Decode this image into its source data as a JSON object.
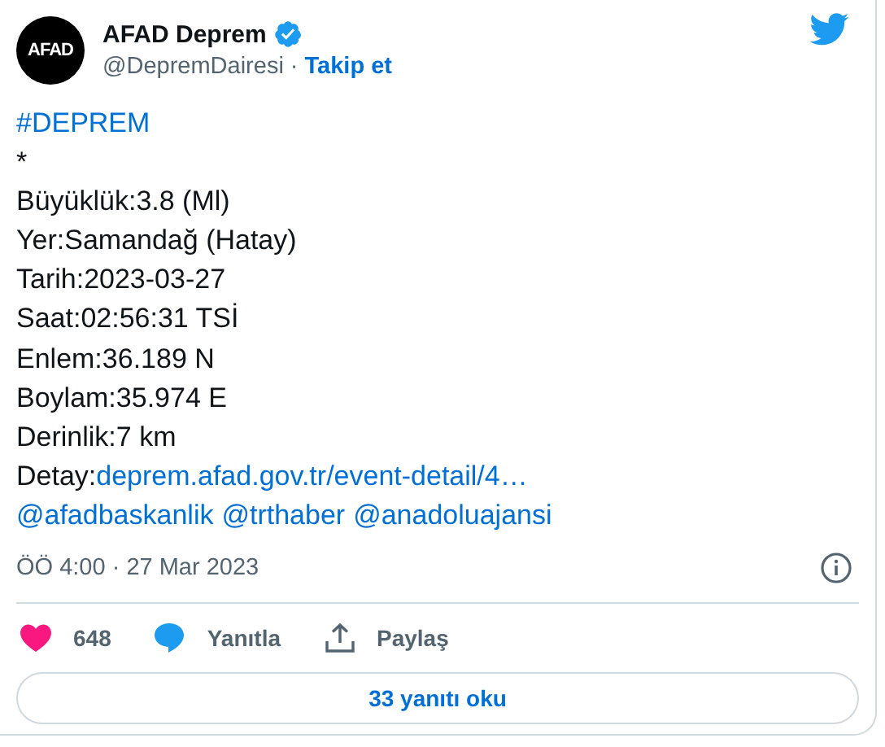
{
  "author": {
    "avatar_text": "AFAD",
    "name": "AFAD Deprem",
    "verified": true,
    "handle": "@DepremDairesi",
    "separator": "·",
    "follow": "Takip et"
  },
  "body": [
    [
      {
        "kind": "link",
        "text": "#DEPREM"
      }
    ],
    [
      {
        "kind": "text",
        "text": "*"
      }
    ],
    [
      {
        "kind": "text",
        "text": "Büyüklük:3.8 (Ml)"
      }
    ],
    [
      {
        "kind": "text",
        "text": "Yer:Samandağ (Hatay)"
      }
    ],
    [
      {
        "kind": "text",
        "text": "Tarih:2023-03-27"
      }
    ],
    [
      {
        "kind": "text",
        "text": "Saat:02:56:31 TSİ"
      }
    ],
    [
      {
        "kind": "text",
        "text": "Enlem:36.189 N"
      }
    ],
    [
      {
        "kind": "text",
        "text": "Boylam:35.974 E"
      }
    ],
    [
      {
        "kind": "text",
        "text": "Derinlik:7 km"
      }
    ],
    [
      {
        "kind": "text",
        "text": "Detay:"
      },
      {
        "kind": "link",
        "text": "deprem.afad.gov.tr/event-detail/4…"
      }
    ],
    [
      {
        "kind": "link",
        "text": "@afadbaskanlik"
      },
      {
        "kind": "link",
        "text": "@trthaber"
      },
      {
        "kind": "link",
        "text": "@anadoluajansi"
      }
    ]
  ],
  "timestamp": "ÖÖ 4:00 · 27 Mar 2023",
  "actions": [
    {
      "kind": "like",
      "label": "648"
    },
    {
      "kind": "reply",
      "label": "Yanıtla"
    },
    {
      "kind": "share",
      "label": "Paylaş"
    }
  ],
  "replies_button": "33 yanıtı oku"
}
